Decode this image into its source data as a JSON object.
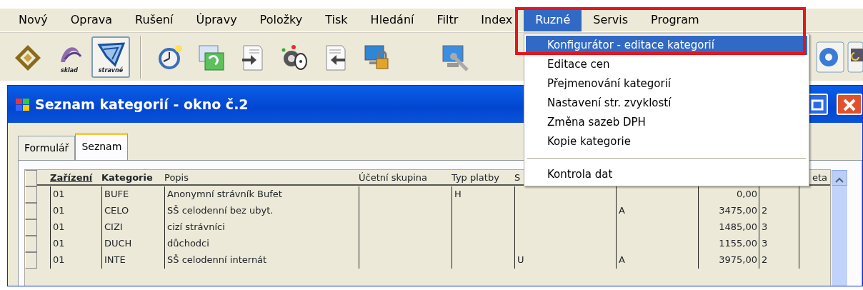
{
  "menu_bar": [
    {
      "label": "Nový",
      "selected": false
    },
    {
      "label": "Oprava",
      "selected": false
    },
    {
      "label": "Rušení",
      "selected": false
    },
    {
      "label": "Úpravy",
      "selected": false
    },
    {
      "label": "Položky",
      "selected": false
    },
    {
      "label": "Tisk",
      "selected": false
    },
    {
      "label": "Hledání",
      "selected": false
    },
    {
      "label": "Filtr",
      "selected": false
    },
    {
      "label": "Index",
      "selected": false
    },
    {
      "label": "Ruzné",
      "selected": true
    },
    {
      "label": "Servis",
      "selected": false
    },
    {
      "label": "Program",
      "selected": false
    }
  ],
  "toolbar": {
    "modules": [
      {
        "kind": "organizer",
        "pressed": false
      },
      {
        "kind": "sklad",
        "label": "sklad",
        "pressed": false
      },
      {
        "kind": "stravne",
        "label": "stravné",
        "pressed": true
      }
    ]
  },
  "dropdown": [
    {
      "kind": "item",
      "label": "Konfigurátor - editace kategorií",
      "selected": true
    },
    {
      "kind": "item",
      "label": "Editace cen",
      "selected": false
    },
    {
      "kind": "item",
      "label": "Přejmenování kategorií",
      "selected": false
    },
    {
      "kind": "item",
      "label": "Nastavení str. zvyklostí",
      "selected": false
    },
    {
      "kind": "item",
      "label": "Změna sazeb DPH",
      "selected": false
    },
    {
      "kind": "item",
      "label": "Kopie kategorie",
      "selected": false
    },
    {
      "kind": "separator"
    },
    {
      "kind": "item",
      "label": "Kontrola dat",
      "selected": false
    }
  ],
  "window": {
    "title": "Seznam kategorií - okno č.2"
  },
  "tabs": [
    {
      "label": "Formulář",
      "selected": false
    },
    {
      "label": "Seznam",
      "selected": true
    }
  ],
  "table": {
    "columns": [
      {
        "label": "Zařízení",
        "sorted": true,
        "bold": true
      },
      {
        "label": "Kategorie",
        "sorted": false,
        "bold": true
      },
      {
        "label": "Popis",
        "sorted": false,
        "bold": false
      },
      {
        "label": "Účetní skupina",
        "sorted": false,
        "bold": false
      },
      {
        "label": "Typ platby",
        "sorted": false,
        "bold": false
      },
      {
        "label": "S",
        "sorted": false,
        "bold": false
      },
      {},
      {},
      {},
      {
        "label": "eta",
        "sorted": false,
        "bold": false
      }
    ],
    "rows": [
      [
        "01",
        "BUFE",
        "Anonymní strávník Bufet",
        null,
        "H",
        null,
        null,
        "0,00",
        null,
        null
      ],
      [
        "01",
        "CELO",
        "SŠ celodenní bez ubyt.",
        null,
        null,
        null,
        "A",
        "3475,00",
        "2",
        null
      ],
      [
        "01",
        "CIZI",
        "cizí strávníci",
        null,
        null,
        null,
        null,
        "1485,00",
        "3",
        null
      ],
      [
        "01",
        "DUCH",
        "důchodci",
        null,
        null,
        null,
        null,
        "1155,00",
        "3",
        null
      ],
      [
        "01",
        "INTE",
        "SŠ celodenní internát",
        null,
        null,
        "U",
        "A",
        "3975,00",
        "2",
        null
      ]
    ]
  }
}
